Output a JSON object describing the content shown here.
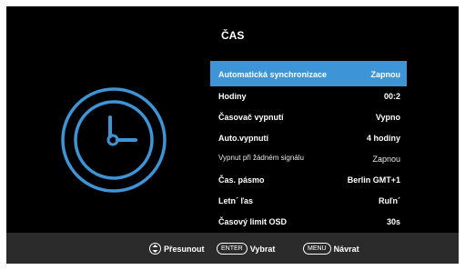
{
  "menu": {
    "title": "ČAS",
    "items": [
      {
        "label": "Automatická synchronizace",
        "value": "Zapnou",
        "selected": true
      },
      {
        "label": "Hodiny",
        "value": "00:2"
      },
      {
        "label": "Časovač vypnutí",
        "value": "Vypno"
      },
      {
        "label": "Auto.vypnutí",
        "value": "4 hodiny"
      },
      {
        "label": "Vypnut při žádném signálu",
        "value": "Zapnou"
      },
      {
        "label": "Čas. pásmo",
        "value": "Berlin GMT+1"
      },
      {
        "label": "Letn´ ľas",
        "value": "Ruľn´"
      },
      {
        "label": "Časový limit OSD",
        "value": "30s"
      }
    ]
  },
  "footer": {
    "move_label": "Přesunout",
    "enter_key": "ENTER",
    "select_label": "Vybrat",
    "menu_key": "MENU",
    "back_label": "Návrat"
  },
  "icons": {
    "main": "clock-icon",
    "move": "up-down-arrows-icon"
  },
  "colors": {
    "background": "#000000",
    "highlight": "#3d94d6",
    "clock": "#3d94d6",
    "footer": "#2b2b2b"
  }
}
